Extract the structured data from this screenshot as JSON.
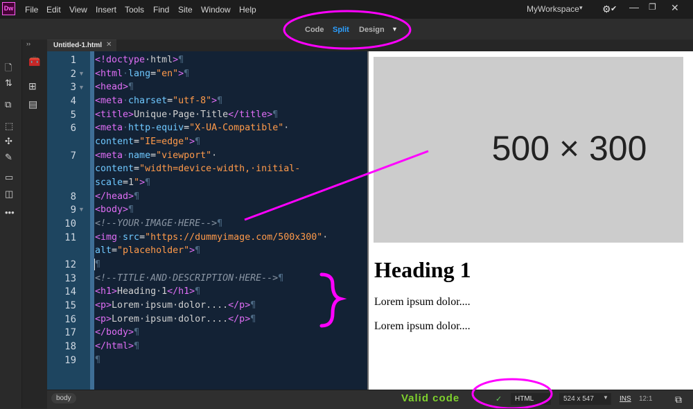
{
  "app": {
    "logo_text": "Dw"
  },
  "menubar": {
    "items": [
      "File",
      "Edit",
      "View",
      "Insert",
      "Tools",
      "Find",
      "Site",
      "Window",
      "Help"
    ],
    "workspace": "MyWorkspace",
    "icons": [
      "chevron-down-icon",
      "gear-icon",
      "check-icon",
      "minimize-icon",
      "maximize-icon",
      "close-icon"
    ]
  },
  "view_switcher": {
    "code": "Code",
    "split": "Split",
    "design": "Design",
    "active": "Split",
    "active_color": "#2d9fff"
  },
  "document_tab": {
    "label": "Untitled-1.html"
  },
  "editor": {
    "line_numbers": [
      "1",
      "2",
      "3",
      "4",
      "5",
      "6",
      "7",
      "8",
      "9",
      "10",
      "11",
      "12",
      "13",
      "14",
      "15",
      "16",
      "17",
      "18",
      "19"
    ],
    "lines": [
      "<!doctype·html>¶",
      "<html·lang=\"en\">¶",
      "<head>¶",
      "<meta·charset=\"utf-8\">¶",
      "<title>Unique·Page·Title</title>¶",
      "<meta·http-equiv=\"X-UA-Compatible\"·",
      "content=\"IE=edge\">¶",
      "<meta·name=\"viewport\"·",
      "content=\"width=device-width,·initial-",
      "scale=1\">¶",
      "</head>¶",
      "<body>¶",
      "<!--YOUR·IMAGE·HERE-->¶",
      "<img·src=\"https://dummyimage.com/500x300\"·",
      "alt=\"placeholder\">¶",
      "¶",
      "<!--TITLE·AND·DESCRIPTION·HERE-->¶",
      "<h1>Heading·1</h1>¶",
      "<p>Lorem·ipsum·dolor....</p>¶",
      "<p>Lorem·ipsum·dolor....</p>¶",
      "</body>¶",
      "</html>¶",
      "¶"
    ]
  },
  "design_view": {
    "image_placeholder": "500 × 300",
    "heading": "Heading 1",
    "paragraphs": [
      "Lorem ipsum dolor....",
      "Lorem ipsum dolor...."
    ]
  },
  "status_bar": {
    "tag": "body",
    "valid_text": "Valid code",
    "doc_type": "HTML",
    "window_size": "524 x 547",
    "mode": "INS",
    "cursor": "12:1"
  },
  "annotation_color": "#ff00ff"
}
